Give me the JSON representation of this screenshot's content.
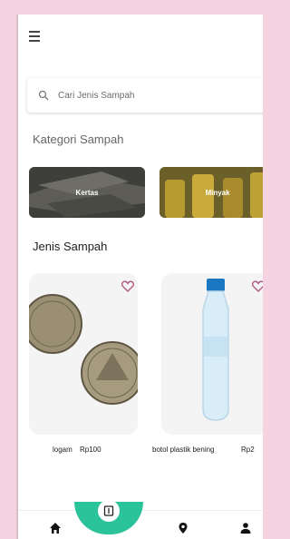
{
  "search": {
    "placeholder": "Cari Jenis Sampah"
  },
  "sections": {
    "categories_title": "Kategori Sampah",
    "types_title": "Jenis Sampah"
  },
  "categories": [
    {
      "label": "Kertas"
    },
    {
      "label": "Minyak"
    }
  ],
  "items": [
    {
      "name": "logam",
      "price": "Rp100"
    },
    {
      "name": "botol plastik bening",
      "price": "Rp2"
    }
  ],
  "bottom_nav": [
    "home-icon",
    "book-icon",
    "location-icon",
    "person-icon"
  ],
  "colors": {
    "accent": "#2ac39a",
    "heart": "#b0507a",
    "background": "#f5d3e1"
  }
}
